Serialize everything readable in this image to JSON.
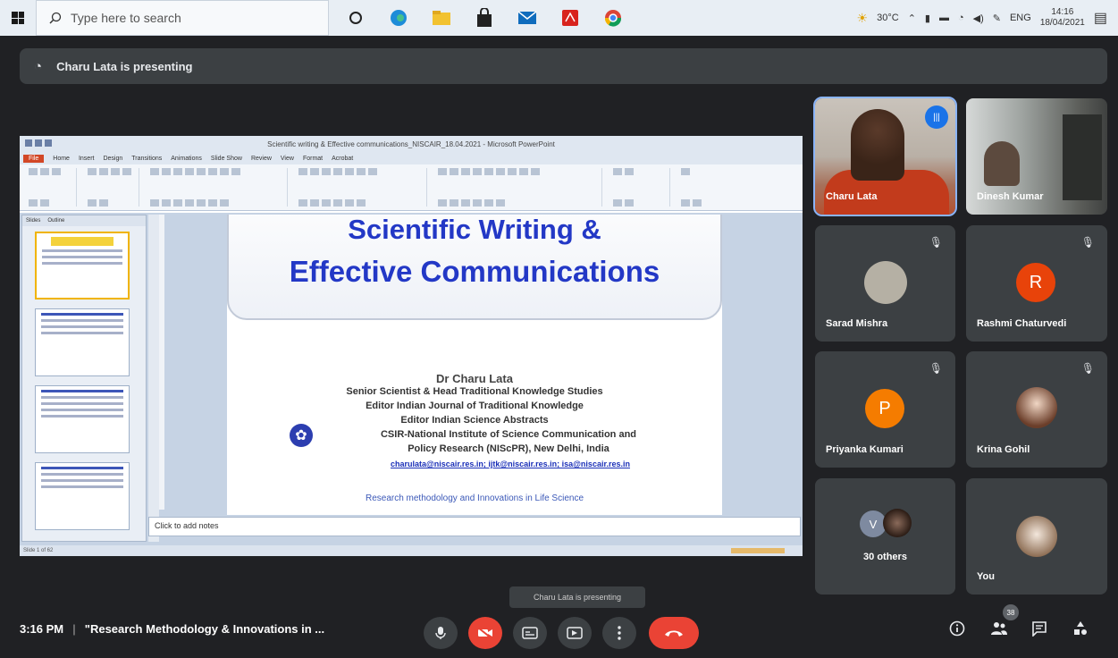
{
  "taskbar": {
    "search_placeholder": "Type here to search",
    "weather": "30°C",
    "language": "ENG",
    "time": "14:16",
    "date": "18/04/2021"
  },
  "banner": {
    "text": "Charu Lata is presenting"
  },
  "presentation": {
    "window_title": "Scientific writing & Effective communications_NISCAIR_18.04.2021 - Microsoft PowerPoint",
    "tabs": [
      "Home",
      "Insert",
      "Design",
      "Transitions",
      "Animations",
      "Slide Show",
      "Review",
      "View",
      "Format",
      "Acrobat"
    ],
    "file_tab": "File",
    "thumbs_tabs": [
      "Slides",
      "Outline"
    ],
    "slide": {
      "title_line1": "Scientific Writing &",
      "title_line2": "Effective Communications",
      "author": "Dr Charu Lata",
      "line1": "Senior Scientist & Head Traditional Knowledge Studies",
      "line2": "Editor Indian Journal of Traditional Knowledge",
      "line3": "Editor Indian Science Abstracts",
      "line4": "CSIR-National Institute of Science Communication and",
      "line5": "Policy Research (NIScPR), New Delhi, India",
      "emails": "charulata@niscair.res.in; ijtk@niscair.res.in; isa@niscair.res.in",
      "footer": "Research methodology and Innovations in Life Science"
    },
    "notes_placeholder": "Click to add notes",
    "status": "Slide 1 of 62"
  },
  "participants": [
    {
      "name": "Charu Lata"
    },
    {
      "name": "Dinesh Kumar"
    },
    {
      "name": "Sarad Mishra"
    },
    {
      "name": "Rashmi Chaturvedi",
      "initial": "R",
      "color": "#e8430a"
    },
    {
      "name": "Priyanka Kumari",
      "initial": "P",
      "color": "#f57c00"
    },
    {
      "name": "Krina Gohil"
    },
    {
      "name": "30 others",
      "initial": "V"
    },
    {
      "name": "You"
    }
  ],
  "bottom": {
    "time": "3:16 PM",
    "meeting_title": "\"Research Methodology & Innovations in ...",
    "tooltip": "Charu Lata is presenting",
    "participant_count": "38"
  },
  "colors": {
    "accent_blue": "#1a73e8",
    "end_call_red": "#ea4335",
    "meet_bg": "#202124",
    "tile_bg": "#3c4043"
  }
}
